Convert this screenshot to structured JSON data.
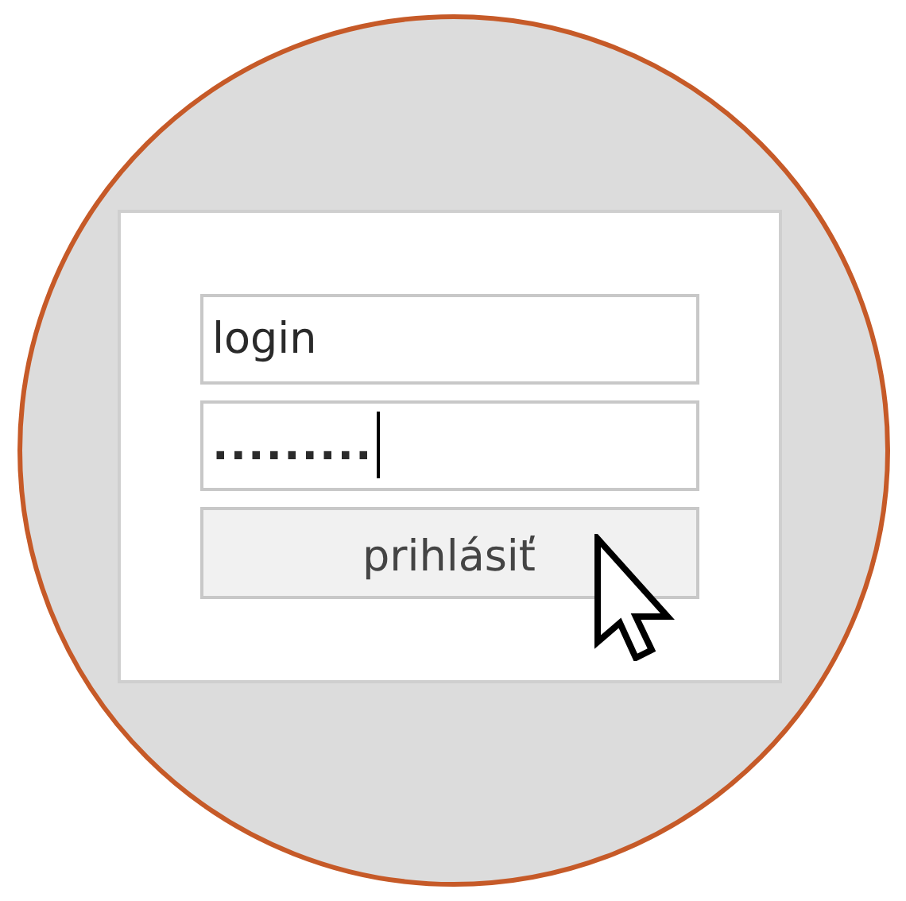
{
  "login_form": {
    "username": {
      "value": "login"
    },
    "password": {
      "value": ".........",
      "focused": true
    },
    "submit_button": {
      "label": "prihlásiť"
    }
  }
}
